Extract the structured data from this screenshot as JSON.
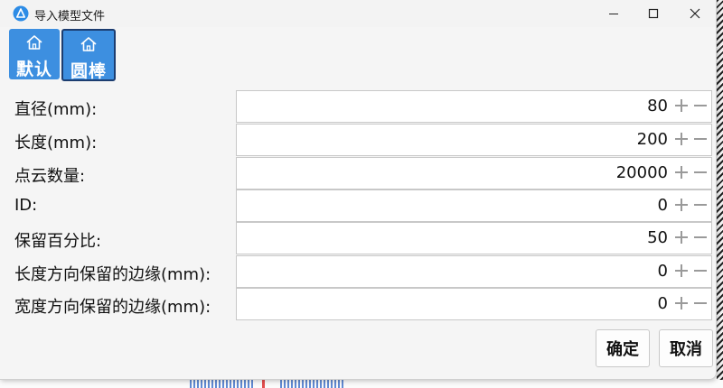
{
  "window": {
    "title": "导入模型文件",
    "accent": "#3d8fe0",
    "icons": {
      "app": "delta-app-icon",
      "minimize": "minimize-icon",
      "maximize": "maximize-icon",
      "close": "close-icon"
    }
  },
  "toolbar": {
    "items": [
      {
        "label": "默认",
        "icon": "home-icon",
        "active": false
      },
      {
        "label": "圆棒",
        "icon": "home-icon",
        "active": true
      }
    ]
  },
  "form": {
    "fields": [
      {
        "label": "直径(mm):",
        "value": "80"
      },
      {
        "label": "长度(mm):",
        "value": "200"
      },
      {
        "label": "点云数量:",
        "value": "20000"
      },
      {
        "label": "ID:",
        "value": "0"
      },
      {
        "label": "保留百分比:",
        "value": "50"
      },
      {
        "label": "长度方向保留的边缘(mm):",
        "value": "0"
      },
      {
        "label": "宽度方向保留的边缘(mm):",
        "value": "0"
      }
    ]
  },
  "actions": {
    "ok_label": "确定",
    "cancel_label": "取消"
  }
}
